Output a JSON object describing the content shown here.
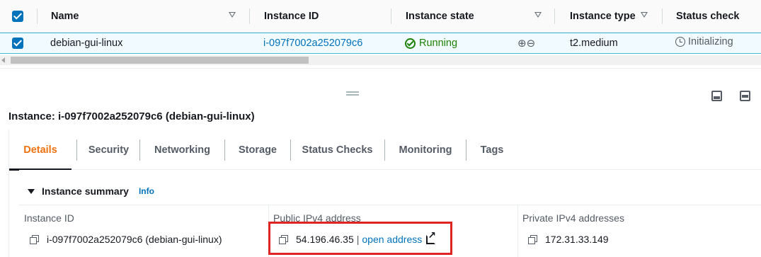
{
  "table": {
    "columns": {
      "name": "Name",
      "instance_id": "Instance ID",
      "instance_state": "Instance state",
      "instance_type": "Instance type",
      "status_check": "Status check"
    },
    "row": {
      "name": "debian-gui-linux",
      "instance_id": "i-097f7002a252079c6",
      "instance_state": "Running",
      "instance_type": "t2.medium",
      "status_check": "Initializing"
    }
  },
  "pane": {
    "title": "Instance: i-097f7002a252079c6 (debian-gui-linux)"
  },
  "tabs": [
    "Details",
    "Security",
    "Networking",
    "Storage",
    "Status Checks",
    "Monitoring",
    "Tags"
  ],
  "summary": {
    "title": "Instance summary",
    "info": "Info",
    "instance_id_label": "Instance ID",
    "instance_id_value": "i-097f7002a252079c6 (debian-gui-linux)",
    "public_ipv4_label": "Public IPv4 address",
    "public_ipv4_value": "54.196.46.35",
    "separator": "|",
    "open_address": "open address",
    "private_ipv4_label": "Private IPv4 addresses",
    "private_ipv4_value": "172.31.33.149"
  },
  "colors": {
    "link": "#0073bb",
    "running": "#1d8102",
    "active_tab": "#ec7211",
    "highlight": "#e02424"
  },
  "icons": [
    "checkbox-icon",
    "sort-icon",
    "check-circle-icon",
    "zoom-in-icon",
    "zoom-out-icon",
    "clock-icon",
    "copy-icon",
    "external-link-icon",
    "caret-down-icon",
    "collapse-icon",
    "split-icon"
  ]
}
